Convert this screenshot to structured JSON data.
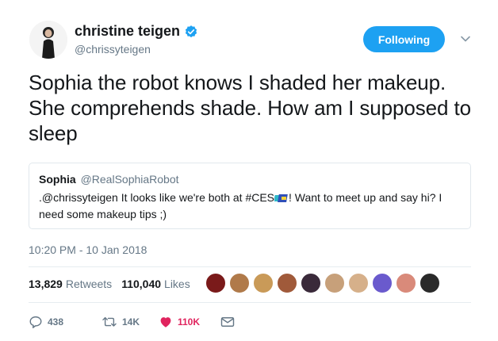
{
  "tweet": {
    "author": {
      "display_name": "christine teigen",
      "handle": "@chrissyteigen",
      "verified": true
    },
    "follow_button_label": "Following",
    "text": "Sophia the robot knows I shaded her makeup. She comprehends shade. How am I supposed to sleep",
    "quoted": {
      "display_name": "Sophia",
      "handle": "@RealSophiaRobot",
      "text_before_hashflag": ".@chrissyteigen It looks like we're both at #CES",
      "text_after_hashflag": "! Want to meet up and say hi? I need some makeup tips ;)"
    },
    "timestamp": "10:20 PM - 10 Jan 2018",
    "stats": {
      "retweets_count": "13,829",
      "retweets_label": "Retweets",
      "likes_count": "110,040",
      "likes_label": "Likes"
    },
    "liker_avatars": [
      {
        "color": "#7a1a1a"
      },
      {
        "color": "#b07a4a"
      },
      {
        "color": "#c99a58"
      },
      {
        "color": "#a05a3a"
      },
      {
        "color": "#3a2a3a"
      },
      {
        "color": "#c7a07a"
      },
      {
        "color": "#d6b08a"
      },
      {
        "color": "#6a5acd"
      },
      {
        "color": "#d98a7a"
      },
      {
        "color": "#2a2a2a"
      }
    ],
    "actions": {
      "replies": "438",
      "retweets": "14K",
      "likes": "110K"
    }
  },
  "colors": {
    "accent": "#1da1f2",
    "like": "#e0245e",
    "muted": "#657786"
  }
}
